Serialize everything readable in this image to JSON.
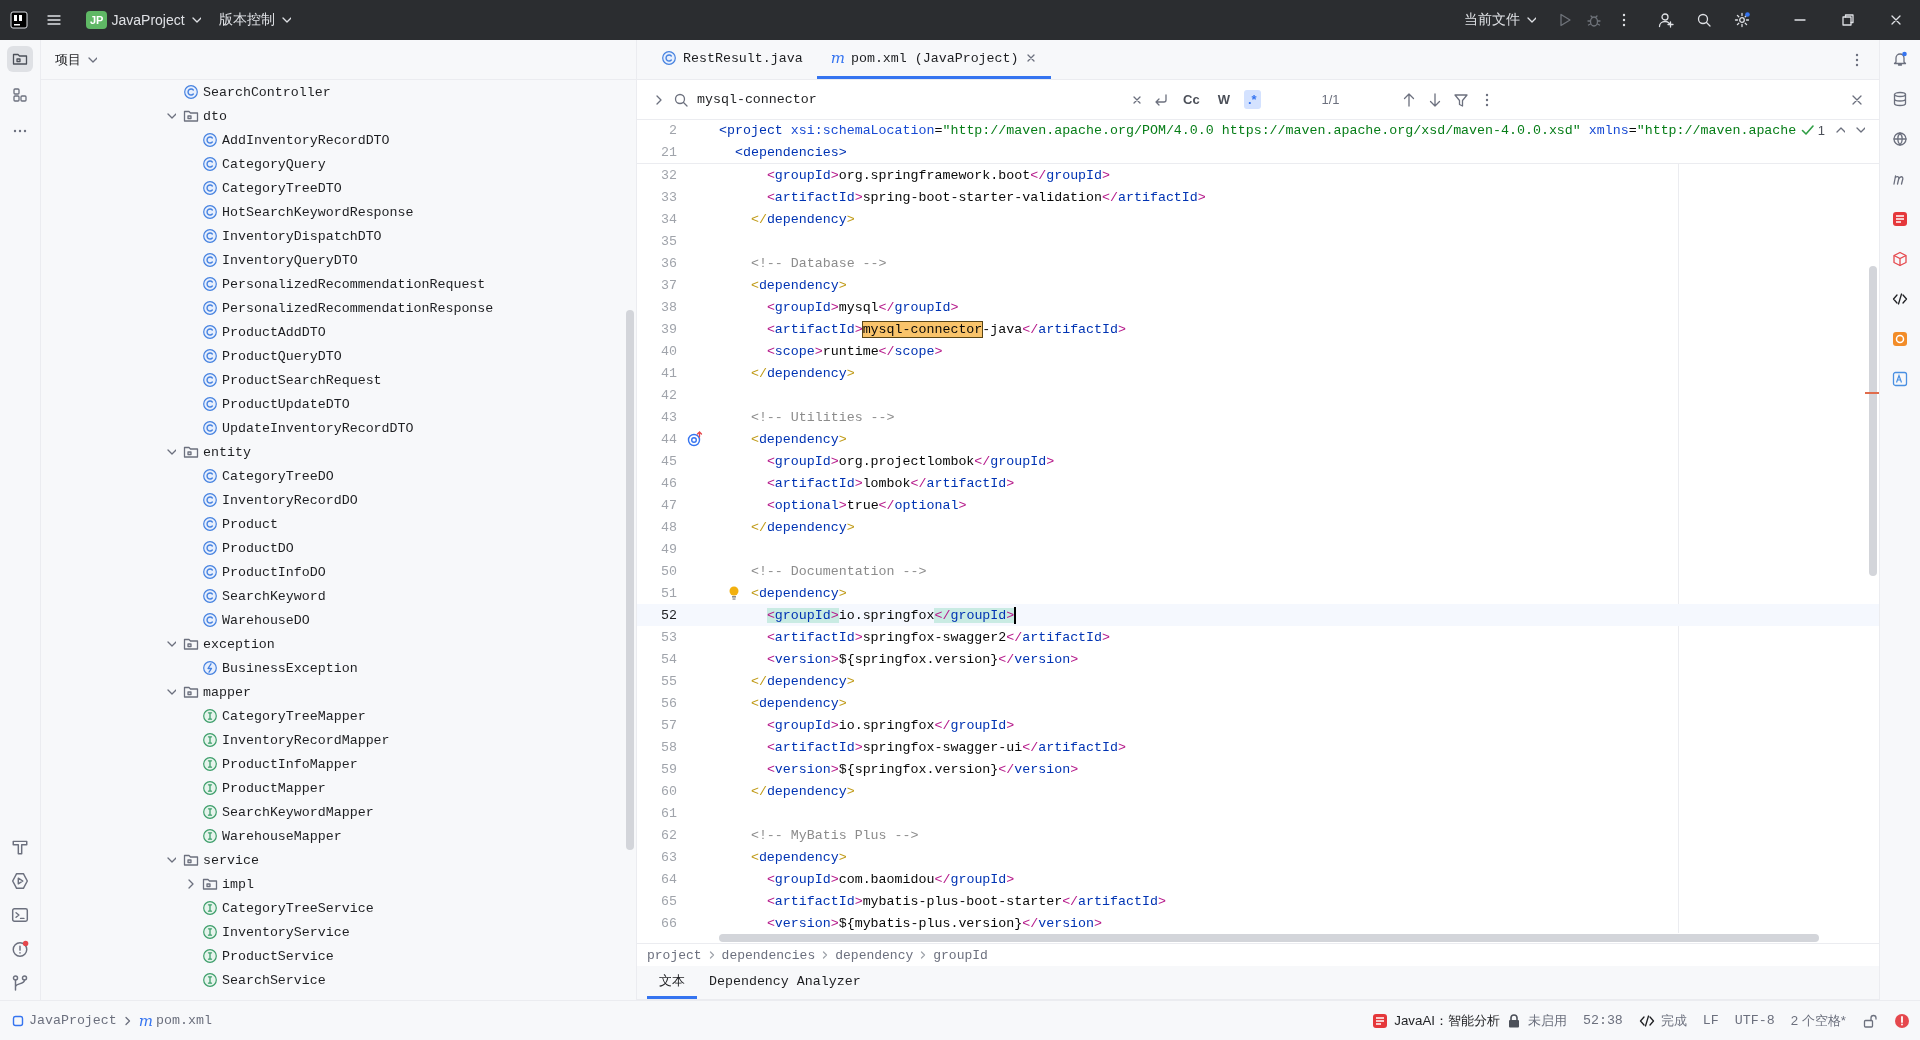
{
  "title_bar": {
    "project_badge": "JP",
    "project": "JavaProject",
    "vcs": "版本控制",
    "run_config": "当前文件"
  },
  "sidebar": {
    "title": "项目",
    "tree": [
      {
        "name": "SearchController",
        "kind": "class"
      },
      {
        "name": "dto",
        "kind": "folder",
        "expanded": true,
        "children": [
          {
            "name": "AddInventoryRecordDTO",
            "kind": "class"
          },
          {
            "name": "CategoryQuery",
            "kind": "class"
          },
          {
            "name": "CategoryTreeDTO",
            "kind": "class"
          },
          {
            "name": "HotSearchKeywordResponse",
            "kind": "class"
          },
          {
            "name": "InventoryDispatchDTO",
            "kind": "class"
          },
          {
            "name": "InventoryQueryDTO",
            "kind": "class"
          },
          {
            "name": "PersonalizedRecommendationRequest",
            "kind": "class"
          },
          {
            "name": "PersonalizedRecommendationResponse",
            "kind": "class"
          },
          {
            "name": "ProductAddDTO",
            "kind": "class"
          },
          {
            "name": "ProductQueryDTO",
            "kind": "class"
          },
          {
            "name": "ProductSearchRequest",
            "kind": "class"
          },
          {
            "name": "ProductUpdateDTO",
            "kind": "class"
          },
          {
            "name": "UpdateInventoryRecordDTO",
            "kind": "class"
          }
        ]
      },
      {
        "name": "entity",
        "kind": "folder",
        "expanded": true,
        "children": [
          {
            "name": "CategoryTreeDO",
            "kind": "class"
          },
          {
            "name": "InventoryRecordDO",
            "kind": "class"
          },
          {
            "name": "Product",
            "kind": "class"
          },
          {
            "name": "ProductDO",
            "kind": "class"
          },
          {
            "name": "ProductInfoDO",
            "kind": "class"
          },
          {
            "name": "SearchKeyword",
            "kind": "class"
          },
          {
            "name": "WarehouseDO",
            "kind": "class"
          }
        ]
      },
      {
        "name": "exception",
        "kind": "folder",
        "expanded": true,
        "children": [
          {
            "name": "BusinessException",
            "kind": "exception"
          }
        ]
      },
      {
        "name": "mapper",
        "kind": "folder",
        "expanded": true,
        "children": [
          {
            "name": "CategoryTreeMapper",
            "kind": "interface"
          },
          {
            "name": "InventoryRecordMapper",
            "kind": "interface"
          },
          {
            "name": "ProductInfoMapper",
            "kind": "interface"
          },
          {
            "name": "ProductMapper",
            "kind": "interface"
          },
          {
            "name": "SearchKeywordMapper",
            "kind": "interface"
          },
          {
            "name": "WarehouseMapper",
            "kind": "interface"
          }
        ]
      },
      {
        "name": "service",
        "kind": "folder",
        "expanded": true,
        "children": [
          {
            "name": "impl",
            "kind": "folder",
            "expanded": false
          },
          {
            "name": "CategoryTreeService",
            "kind": "interface"
          },
          {
            "name": "InventoryService",
            "kind": "interface"
          },
          {
            "name": "ProductService",
            "kind": "interface"
          },
          {
            "name": "SearchService",
            "kind": "interface"
          }
        ]
      }
    ]
  },
  "editor": {
    "tabs": [
      {
        "label": "RestResult.java",
        "kind": "class",
        "selected": false
      },
      {
        "label": "pom.xml (JavaProject)",
        "kind": "maven",
        "icon": "m",
        "selected": true
      }
    ],
    "search": {
      "value": "mysql-connector",
      "options": [
        {
          "label": "Cc",
          "selected": false
        },
        {
          "label": "W",
          "selected": false
        },
        {
          "label": ".*",
          "selected": true
        }
      ],
      "count": "1/1"
    },
    "inspection_count": "1",
    "sticky_lines": [
      {
        "number": "2",
        "text": "<project xsi:schemaLocation=\"http://maven.apache.org/POM/4.0.0 https://maven.apache.org/xsd/maven-4.0.0.xsd\" xmlns=\"http://maven.apache"
      },
      {
        "number": "21",
        "text": "  <dependencies>"
      }
    ],
    "lines": [
      {
        "number": "32",
        "text": "      <groupId>org.springframework.boot</groupId>",
        "current": false
      },
      {
        "number": "33",
        "text": "      <artifactId>spring-boot-starter-validation</artifactId>",
        "current": false
      },
      {
        "number": "34",
        "text": "    </dependency>",
        "current": false
      },
      {
        "number": "35",
        "current": false
      },
      {
        "number": "36",
        "text": "    <!-- Database -->",
        "current": false
      },
      {
        "number": "37",
        "text": "    <dependency>",
        "current": false
      },
      {
        "number": "38",
        "text": "      <groupId>mysql</groupId>",
        "current": false
      },
      {
        "number": "39",
        "text": "      <artifactId>mysql-connector-java</artifactId>",
        "current": false
      },
      {
        "number": "40",
        "text": "      <scope>runtime</scope>",
        "current": false
      },
      {
        "number": "41",
        "text": "    </dependency>",
        "current": false
      },
      {
        "number": "42",
        "current": false
      },
      {
        "number": "43",
        "text": "    <!-- Utilities -->",
        "current": false
      },
      {
        "number": "44",
        "text": "    <dependency>",
        "current": false,
        "gutter": {
          "kind": "override"
        }
      },
      {
        "number": "45",
        "text": "      <groupId>org.projectlombok</groupId>",
        "current": false
      },
      {
        "number": "46",
        "text": "      <artifactId>lombok</artifactId>",
        "current": false
      },
      {
        "number": "47",
        "text": "      <optional>true</optional>",
        "current": false
      },
      {
        "number": "48",
        "text": "    </dependency>",
        "current": false
      },
      {
        "number": "49",
        "current": false
      },
      {
        "number": "50",
        "text": "    <!-- Documentation -->",
        "current": false
      },
      {
        "number": "51",
        "text": "    <dependency>",
        "current": false,
        "gutter": {
          "kind": "bulb"
        }
      },
      {
        "number": "52",
        "text": "      <groupId>io.springfox</groupId>",
        "current": true
      },
      {
        "number": "53",
        "text": "      <artifactId>springfox-swagger2</artifactId>",
        "current": false
      },
      {
        "number": "54",
        "text": "      <version>${springfox.version}</version>",
        "current": false
      },
      {
        "number": "55",
        "text": "    </dependency>",
        "current": false
      },
      {
        "number": "56",
        "text": "    <dependency>",
        "current": false
      },
      {
        "number": "57",
        "text": "      <groupId>io.springfox</groupId>",
        "current": false
      },
      {
        "number": "58",
        "text": "      <artifactId>springfox-swagger-ui</artifactId>",
        "current": false
      },
      {
        "number": "59",
        "text": "      <version>${springfox.version}</version>",
        "current": false
      },
      {
        "number": "60",
        "text": "    </dependency>",
        "current": false
      },
      {
        "number": "61",
        "current": false
      },
      {
        "number": "62",
        "text": "    <!-- MyBatis Plus -->",
        "current": false
      },
      {
        "number": "63",
        "text": "    <dependency>",
        "current": false
      },
      {
        "number": "64",
        "text": "      <groupId>com.baomidou</groupId>",
        "current": false
      },
      {
        "number": "65",
        "text": "      <artifactId>mybatis-plus-boot-starter</artifactId>",
        "current": false
      },
      {
        "number": "66",
        "text": "      <version>${mybatis-plus.version}</version>",
        "current": false
      }
    ],
    "breadcrumbs": [
      "project",
      "dependencies",
      "dependency",
      "groupId"
    ],
    "bottom_tabs": [
      {
        "label": "文本",
        "selected": true
      },
      {
        "label": "Dependency Analyzer",
        "selected": false
      }
    ]
  },
  "status_bar": {
    "path": [
      {
        "label": "JavaProject",
        "kind": "module"
      },
      {
        "label": "pom.xml",
        "kind": "maven",
        "icon": "m"
      }
    ],
    "ai_plugin": "JavaAI：智能分析",
    "ai_state": "未启用",
    "position": "52:38",
    "completion": "完成",
    "line_separator": "LF",
    "encoding": "UTF-8",
    "indent": "2 个空格*"
  }
}
